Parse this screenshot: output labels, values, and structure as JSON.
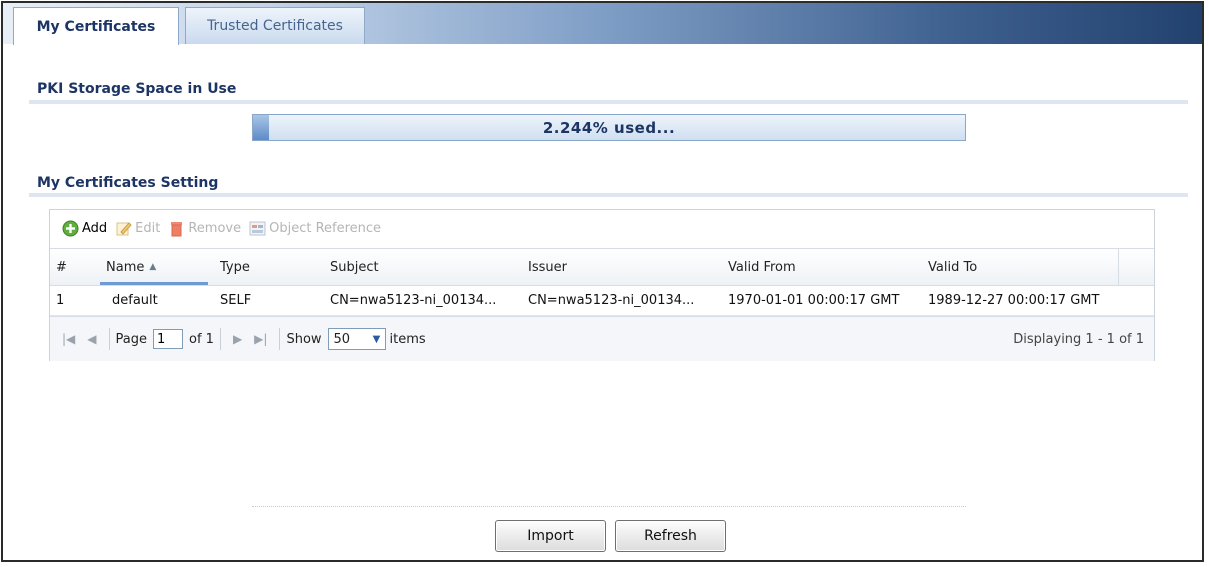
{
  "tabs": [
    {
      "label": "My Certificates",
      "active": true
    },
    {
      "label": "Trusted Certificates",
      "active": false
    }
  ],
  "storage": {
    "title": "PKI Storage Space in Use",
    "used_percent": 2.244,
    "text": "2.244% used..."
  },
  "settings": {
    "title": "My Certificates Setting",
    "toolbar": {
      "add_label": "Add",
      "edit_label": "Edit",
      "remove_label": "Remove",
      "object_reference_label": "Object Reference"
    },
    "columns": [
      "#",
      "Name",
      "Type",
      "Subject",
      "Issuer",
      "Valid From",
      "Valid To"
    ],
    "rows": [
      {
        "num": "1",
        "name": "default",
        "type": "SELF",
        "subject": "CN=nwa5123-ni_00134...",
        "issuer": "CN=nwa5123-ni_00134...",
        "valid_from": "1970-01-01 00:00:17 GMT",
        "valid_to": "1989-12-27 00:00:17 GMT"
      }
    ],
    "pager": {
      "page_label": "Page",
      "page_value": "1",
      "of_label": "of 1",
      "show_label": "Show",
      "show_value": "50",
      "items_label": "items",
      "displaying": "Displaying 1 - 1 of 1"
    }
  },
  "buttons": {
    "import_label": "Import",
    "refresh_label": "Refresh"
  },
  "colors": {
    "title": "#1d3565",
    "accent": "#6c9bd5"
  }
}
